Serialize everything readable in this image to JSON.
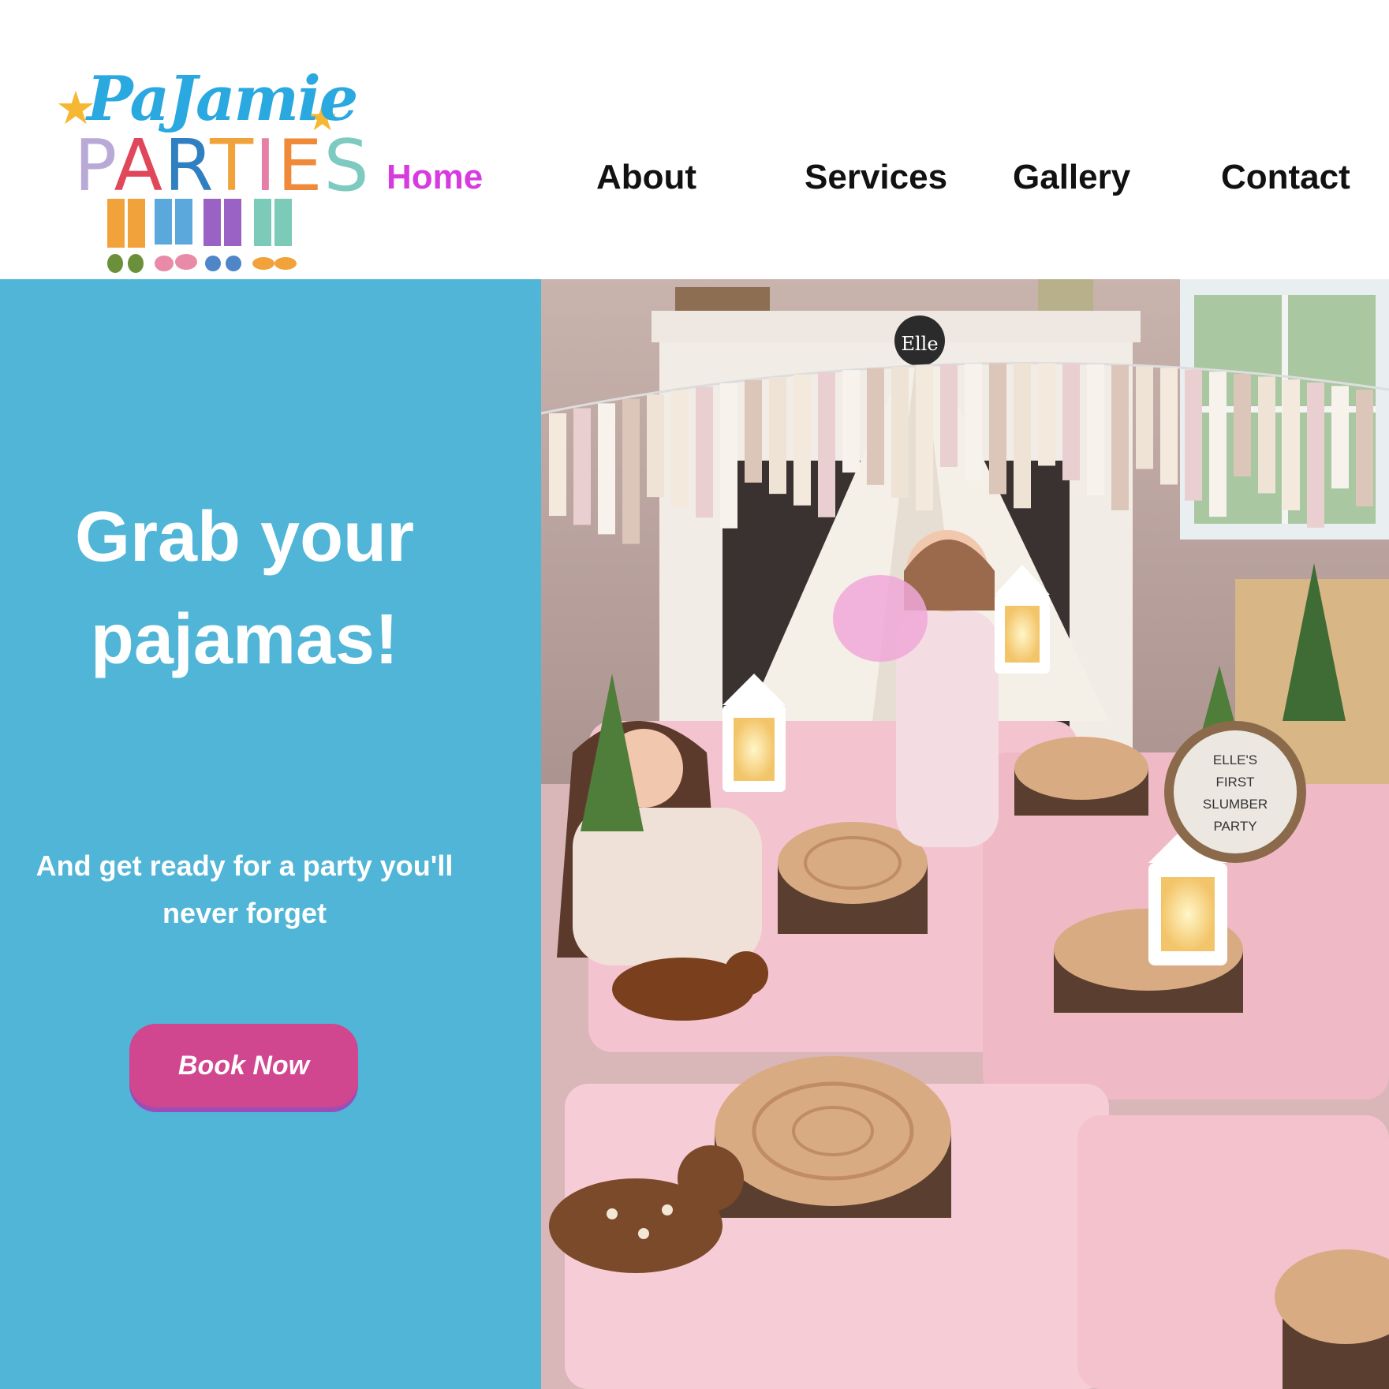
{
  "brand": {
    "script_word": "PaJamie",
    "word_letters": [
      {
        "ch": "P",
        "color": "#b9a9d6"
      },
      {
        "ch": "A",
        "color": "#e0475a"
      },
      {
        "ch": "R",
        "color": "#2f7fc1"
      },
      {
        "ch": "T",
        "color": "#f2a23a"
      },
      {
        "ch": "I",
        "color": "#e57fa6"
      },
      {
        "ch": "E",
        "color": "#ef8a3a"
      },
      {
        "ch": "S",
        "color": "#7ccac0"
      }
    ]
  },
  "nav": {
    "items": [
      {
        "label": "Home",
        "active": true
      },
      {
        "label": "About",
        "active": false
      },
      {
        "label": "Services",
        "active": false
      },
      {
        "label": "Gallery",
        "active": false
      },
      {
        "label": "Contact",
        "active": false
      }
    ],
    "active_color": "#d63be0"
  },
  "hero": {
    "headline_line1": "Grab your",
    "headline_line2": "pajamas!",
    "subline_line1": "And get ready for a party you'll",
    "subline_line2": "never forget",
    "cta_label": "Book Now",
    "panel_color": "#50b5d6",
    "cta_color": "#d0468f"
  },
  "photo": {
    "sign_line1": "ELLE'S",
    "sign_line2": "FIRST",
    "sign_line3": "SLUMBER",
    "sign_line4": "PARTY",
    "tent_tag": "Elle"
  }
}
